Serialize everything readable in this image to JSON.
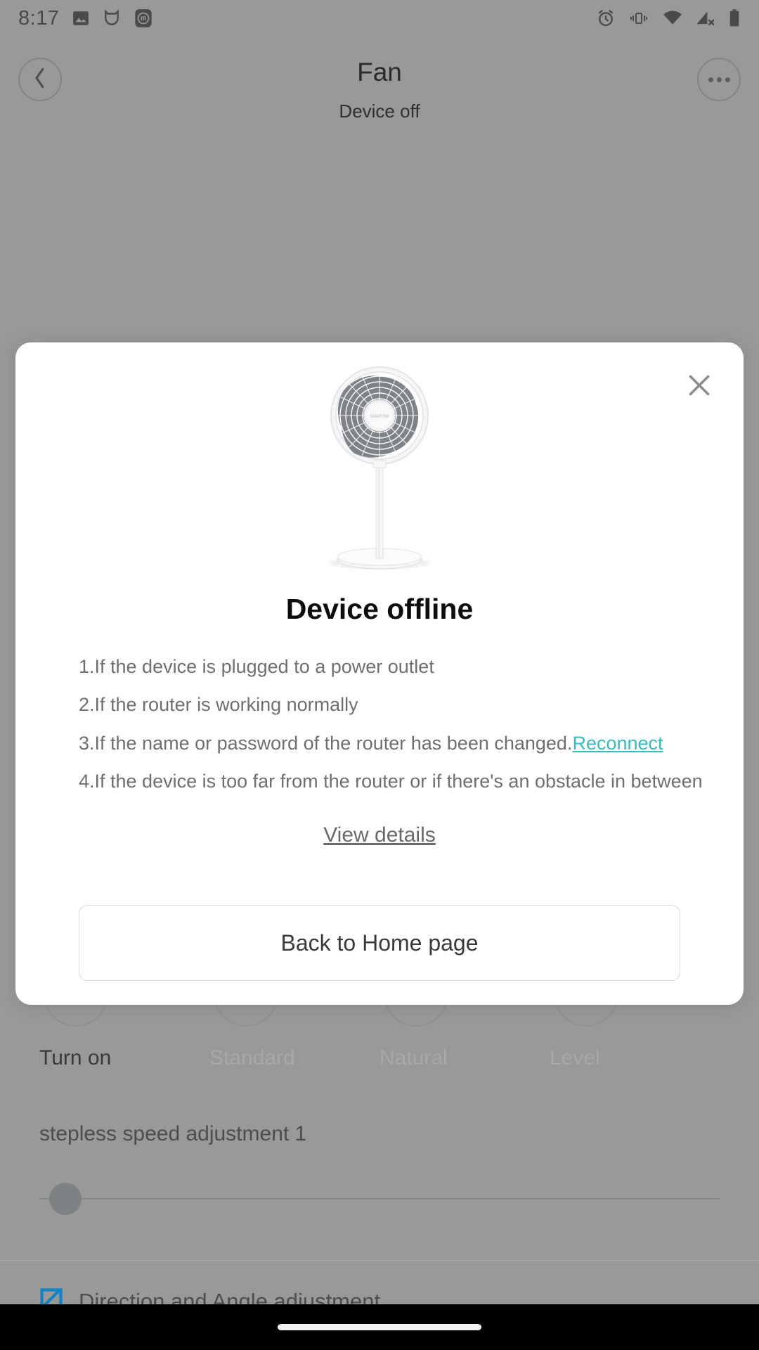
{
  "status_bar": {
    "time": "8:17",
    "left_icons": [
      "photo-icon",
      "miui-cat-icon",
      "mi-app-icon"
    ],
    "right_icons": [
      "alarm-icon",
      "vibrate-icon",
      "wifi-icon",
      "cellular-no-signal-icon",
      "battery-icon"
    ]
  },
  "header": {
    "title": "Fan",
    "subtitle": "Device off",
    "back_icon": "chevron-left-icon",
    "more_icon": "more-horizontal-icon"
  },
  "background_controls": {
    "modes": [
      {
        "label": "Turn on",
        "state": "active"
      },
      {
        "label": "Standard",
        "state": "dim"
      },
      {
        "label": "Natural",
        "state": "dim"
      },
      {
        "label": "Level",
        "state": "dim"
      }
    ],
    "slider": {
      "label": "stepless speed adjustment 1",
      "value": 1,
      "min": 1,
      "max": 100
    },
    "direction": {
      "label": "Direction and Angle adjustment",
      "icon": "angle-adjust-icon",
      "icon_color": "#1283c3"
    }
  },
  "dialog": {
    "close_icon": "close-icon",
    "device_image": "pedestal-fan-illustration",
    "title": "Device offline",
    "reasons": [
      {
        "text": "1.If the device is plugged to a power outlet"
      },
      {
        "text": "2.If the router is working normally"
      },
      {
        "text": "3.If the name or password of the router has been changed.",
        "link": "Reconnect"
      },
      {
        "text": "4.If the device is too far from the router or if there's an obstacle in between"
      }
    ],
    "view_details": "View details",
    "primary_button": "Back to Home page",
    "link_color": "#35bcc3"
  }
}
